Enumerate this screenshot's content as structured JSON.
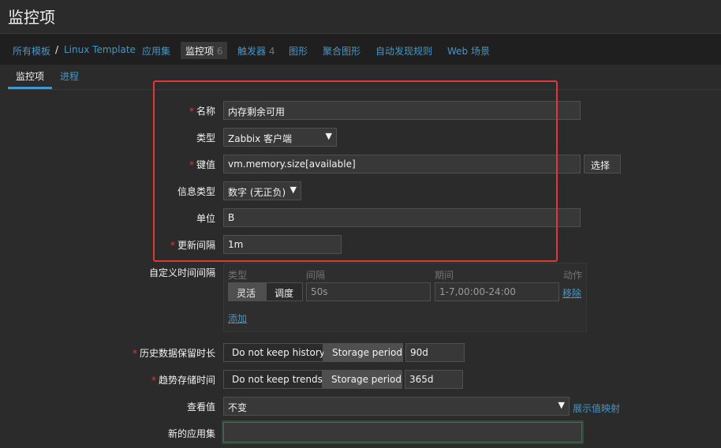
{
  "header": {
    "title": "监控项"
  },
  "nav": {
    "all_templates": "所有模板",
    "separator": "/",
    "template_name": "Linux Template",
    "applications": "应用集",
    "items": "监控项",
    "items_count": "6",
    "triggers": "触发器",
    "triggers_count": "4",
    "graphs": "图形",
    "screens": "聚合图形",
    "discovery": "自动发现规则",
    "web": "Web 场景"
  },
  "tabs": {
    "item": "监控项",
    "process": "进程"
  },
  "form": {
    "name": {
      "label": "名称",
      "value": "内存剩余可用",
      "required": true
    },
    "type": {
      "label": "类型",
      "value": "Zabbix 客户端"
    },
    "key": {
      "label": "键值",
      "value": "vm.memory.size[available]",
      "select_button": "选择",
      "required": true
    },
    "info_type": {
      "label": "信息类型",
      "value": "数字 (无正负)"
    },
    "units": {
      "label": "单位",
      "value": "B"
    },
    "interval": {
      "label": "更新间隔",
      "value": "1m",
      "required": true
    },
    "custom_intervals": {
      "label": "自定义时间间隔",
      "headers": {
        "type": "类型",
        "interval": "间隔",
        "period": "期间",
        "action": "动作"
      },
      "flexible": "灵活",
      "scheduling": "调度",
      "interval_placeholder": "50s",
      "period_placeholder": "1-7,00:00-24:00",
      "remove": "移除",
      "add": "添加"
    },
    "history": {
      "label": "历史数据保留时长",
      "no_keep": "Do not keep history",
      "storage": "Storage period",
      "value": "90d",
      "required": true
    },
    "trends": {
      "label": "趋势存储时间",
      "no_keep": "Do not keep trends",
      "storage": "Storage period",
      "value": "365d",
      "required": true
    },
    "valuemap": {
      "label": "查看值",
      "value": "不变",
      "link": "展示值映射"
    },
    "new_application": {
      "label": "新的应用集",
      "value": ""
    }
  },
  "colors": {
    "accent": "#4796c4",
    "required": "#e33734",
    "highlight_box": "#e33734"
  }
}
